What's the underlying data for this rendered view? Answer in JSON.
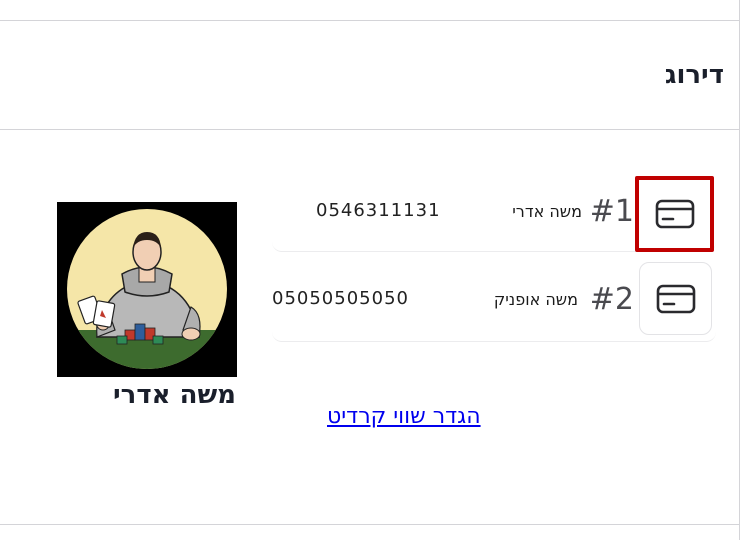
{
  "section": {
    "title": "דירוג"
  },
  "ranking": [
    {
      "rank": "#1",
      "name": "משה אדרי",
      "phone": "0546311131",
      "selected": true
    },
    {
      "rank": "#2",
      "name": "משה אופניק",
      "phone": "05050505050",
      "selected": false
    }
  ],
  "profile": {
    "name": "משה אדרי"
  },
  "actions": {
    "set_credit_label": "הגדר שווי קרדיט"
  },
  "icons": {
    "card": "credit-card-icon",
    "avatar": "poker-player-avatar"
  },
  "colors": {
    "highlight": "#c00000",
    "link": "#0000ee",
    "avatar_bg": "#f5e6a8",
    "table": "#3d6b2e"
  }
}
